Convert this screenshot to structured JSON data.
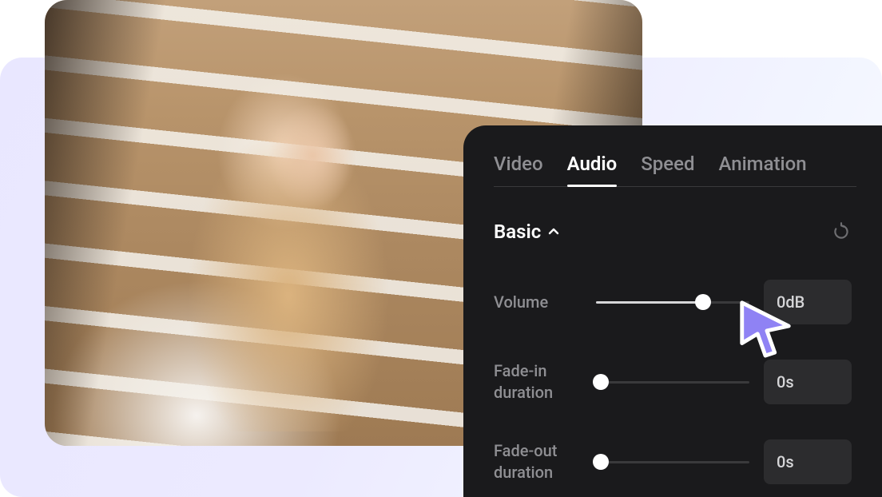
{
  "tabs": {
    "video": "Video",
    "audio": "Audio",
    "speed": "Speed",
    "animation": "Animation",
    "active": "audio"
  },
  "section": {
    "title": "Basic"
  },
  "sliders": {
    "volume": {
      "label": "Volume",
      "value": "0dB",
      "percent": 70
    },
    "fade_in": {
      "label": "Fade-in\nduration",
      "value": "0s",
      "percent": 0
    },
    "fade_out": {
      "label": "Fade-out\nduration",
      "value": "0s",
      "percent": 0
    }
  },
  "colors": {
    "cursor": "#8f82f4"
  }
}
